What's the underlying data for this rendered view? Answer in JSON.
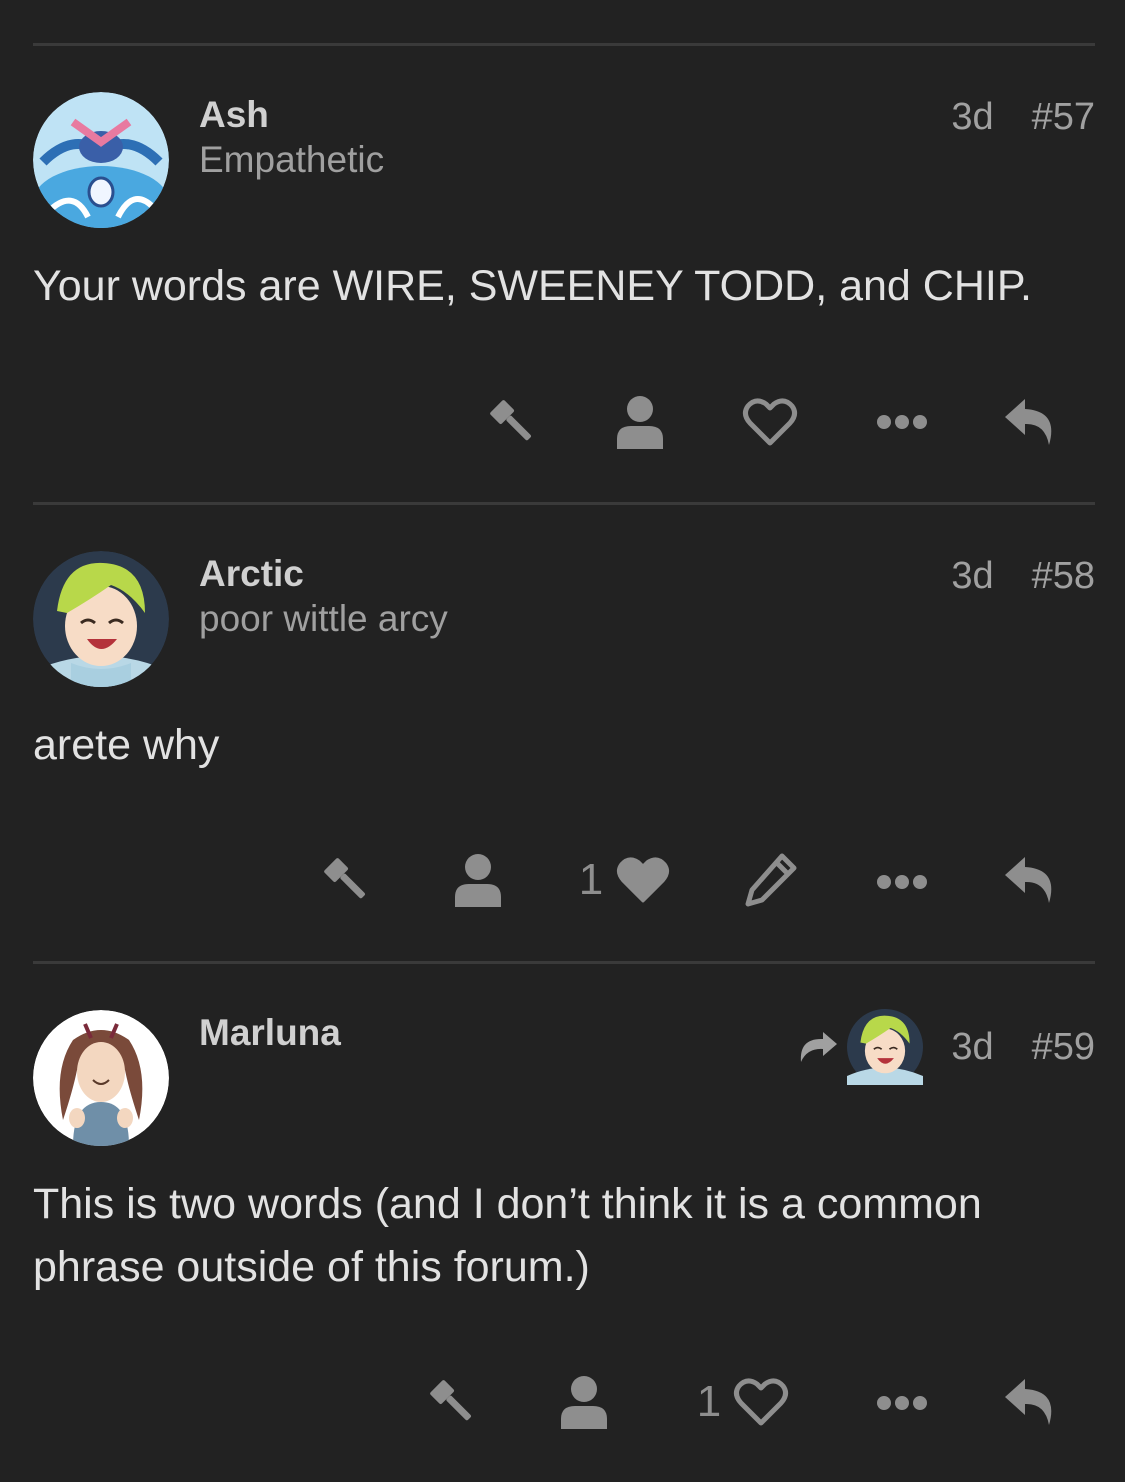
{
  "posts": [
    {
      "username": "Ash",
      "user_title": "Empathetic",
      "age": "3d",
      "post_number": "#57",
      "body": "Your words are WIRE, SWEENEY TODD, and CHIP.",
      "like_count": "",
      "liked": false
    },
    {
      "username": "Arctic",
      "user_title": "poor wittle arcy",
      "age": "3d",
      "post_number": "#58",
      "body": "arete why",
      "like_count": "1",
      "liked": true
    },
    {
      "username": "Marluna",
      "user_title": "",
      "age": "3d",
      "post_number": "#59",
      "body": "This is two words (and I don’t think it is a common phrase outside of this forum.)",
      "like_count": "1",
      "liked": false
    }
  ],
  "icons": {
    "flag": "gavel-icon",
    "user": "user-icon",
    "like": "heart-icon",
    "edit": "pencil-icon",
    "more": "ellipsis-icon",
    "reply": "reply-icon",
    "reply_to": "share-arrow-icon"
  },
  "colors": {
    "background": "#222222",
    "text": "#e2e2e2",
    "muted": "#a0a0a0",
    "icon": "#8e8e8e",
    "divider": "#3a3a3a"
  }
}
